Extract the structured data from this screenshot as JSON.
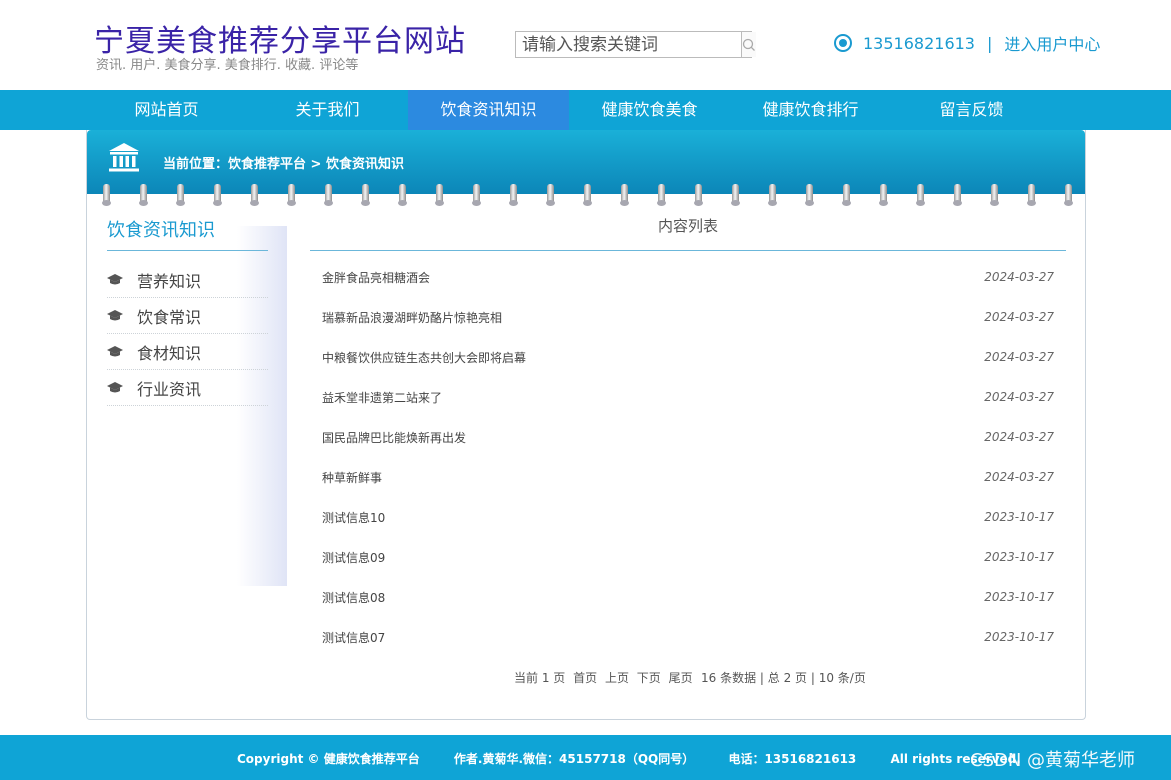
{
  "header": {
    "title": "宁夏美食推荐分享平台网站",
    "subtitle": "资讯. 用户. 美食分享. 美食排行. 收藏. 评论等",
    "search_placeholder": "请输入搜索关键词",
    "phone": "13516821613",
    "separator": "|",
    "user_center": "进入用户中心"
  },
  "nav": {
    "items": [
      "网站首页",
      "关于我们",
      "饮食资讯知识",
      "健康饮食美食",
      "健康饮食排行",
      "留言反馈"
    ],
    "active_index": 2
  },
  "breadcrumb": {
    "text": "当前位置：饮食推荐平台 > 饮食资讯知识"
  },
  "sidebar": {
    "title": "饮食资讯知识",
    "items": [
      "营养知识",
      "饮食常识",
      "食材知识",
      "行业资讯"
    ]
  },
  "content": {
    "title": "内容列表",
    "rows": [
      {
        "title": "金胖食品亮相糖酒会",
        "date": "2024-03-27"
      },
      {
        "title": "瑞慕新品浪漫湖畔奶酪片惊艳亮相",
        "date": "2024-03-27"
      },
      {
        "title": "中粮餐饮供应链生态共创大会即将启幕",
        "date": "2024-03-27"
      },
      {
        "title": "益禾堂非遗第二站来了",
        "date": "2024-03-27"
      },
      {
        "title": "国民品牌巴比能焕新再出发",
        "date": "2024-03-27"
      },
      {
        "title": "种草新鲜事",
        "date": "2024-03-27"
      },
      {
        "title": "测试信息10",
        "date": "2023-10-17"
      },
      {
        "title": "测试信息09",
        "date": "2023-10-17"
      },
      {
        "title": "测试信息08",
        "date": "2023-10-17"
      },
      {
        "title": "测试信息07",
        "date": "2023-10-17"
      }
    ]
  },
  "pager": {
    "current": "当前 1 页",
    "first": "首页",
    "prev": "上页",
    "next": "下页",
    "last": "尾页",
    "summary": "16 条数据 | 总 2 页 | 10 条/页"
  },
  "footer": {
    "copyright": "Copyright © 健康饮食推荐平台",
    "author": "作者.黄菊华.微信：45157718（QQ同号）",
    "tel": "电话：13516821613",
    "rights": "All rights reserved.",
    "watermark": "CSDN @黄菊华老师"
  },
  "colors": {
    "title": "#3a23a7",
    "accent": "#1a9ad0",
    "nav_bg": "#0fa4d6",
    "nav_active": "#2c8ae0"
  },
  "icons": {
    "location": "location-ring-icon",
    "search": "search-icon",
    "breadcrumb": "building-icon",
    "sidebar": "graduation-cap-icon"
  }
}
